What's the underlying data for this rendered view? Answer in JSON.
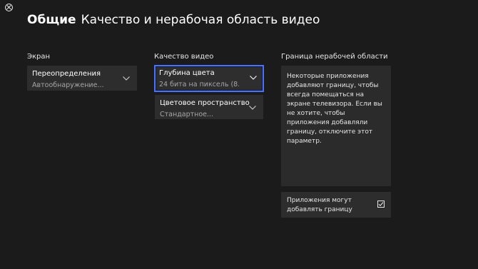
{
  "header": {
    "section": "Общие",
    "title": "Качество и нерабочая область видео",
    "logo_icon": "xbox-logo-icon"
  },
  "columns": {
    "screen": {
      "label": "Экран",
      "dropdowns": [
        {
          "label": "Переопределения",
          "value": "Автообнаружение...",
          "icon": "chevron-down-icon"
        }
      ]
    },
    "video_quality": {
      "label": "Качество видео",
      "dropdowns": [
        {
          "label": "Глубина цвета",
          "value": "24 бита на пиксель (8...",
          "icon": "chevron-down-icon",
          "focused": true
        },
        {
          "label": "Цветовое пространство",
          "value": "Стандартное...",
          "icon": "chevron-down-icon"
        }
      ]
    },
    "overscan": {
      "label": "Граница нерабочей области",
      "description": "Некоторые приложения добавляют границу, чтобы всегда помещаться на экране телевизора. Если вы не хотите, чтобы приложения добавляли границу, отключите этот параметр.",
      "checkbox": {
        "label": "Приложения могут добавлять границу",
        "checked": true,
        "icon": "checkmark-icon"
      }
    }
  },
  "colors": {
    "background": "#1b1b1b",
    "control": "#2d2d2d",
    "focus_border": "#4a72ff",
    "secondary_text": "#a6a6a6"
  }
}
